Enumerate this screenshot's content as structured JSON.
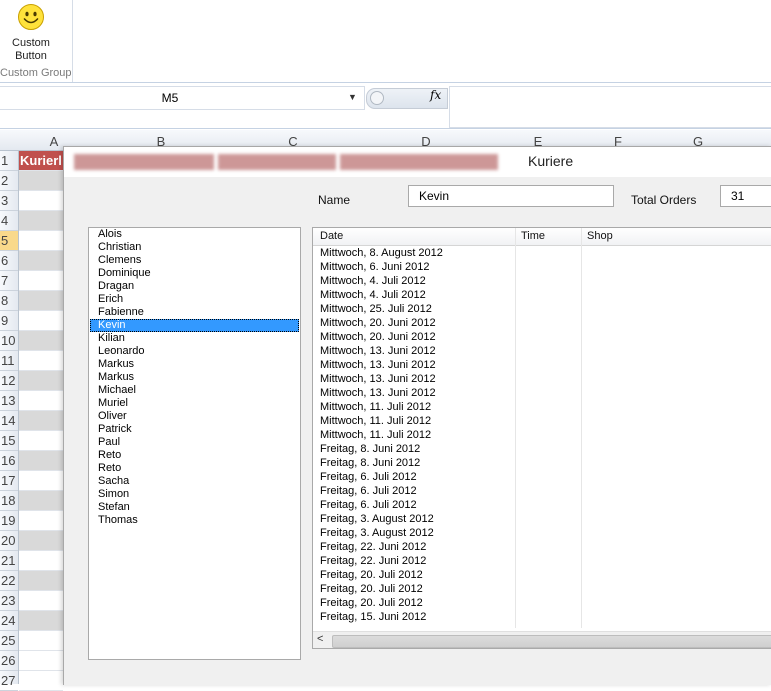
{
  "ribbon": {
    "button_label_1": "Custom",
    "button_label_2": "Button",
    "group_label": "Custom Group"
  },
  "formula_bar": {
    "name_box": "M5",
    "fx_label": "fx",
    "formula": ""
  },
  "sheet": {
    "columns": [
      "A",
      "B",
      "C",
      "D",
      "E",
      "F",
      "G"
    ],
    "rows": [
      "1",
      "2",
      "3",
      "4",
      "5",
      "6",
      "7",
      "8",
      "9",
      "10",
      "11",
      "12",
      "13",
      "14",
      "15",
      "16",
      "17",
      "18",
      "19",
      "20",
      "21",
      "22",
      "23",
      "24",
      "25",
      "26",
      "27"
    ],
    "selected_row": "5",
    "header_cell": "Kurierl"
  },
  "dialog": {
    "title": "Kuriere",
    "name_label": "Name",
    "name_value": "Kevin",
    "total_orders_label": "Total Orders",
    "total_orders_value": "31",
    "couriers": [
      "Alois",
      "Christian",
      "Clemens",
      "Dominique",
      "Dragan",
      "Erich",
      "Fabienne",
      "Kevin",
      "Kilian",
      "Leonardo",
      "Markus",
      "Markus",
      "Michael",
      "Muriel",
      "Oliver",
      "Patrick",
      "Paul",
      "Reto",
      "Reto",
      "Sacha",
      "Simon",
      "Stefan",
      "Thomas"
    ],
    "selected_courier": "Kevin",
    "columns": [
      "Date",
      "Time",
      "Shop"
    ],
    "orders": [
      "Mittwoch, 8. August 2012",
      "Mittwoch, 6. Juni 2012",
      "Mittwoch, 4. Juli 2012",
      "Mittwoch, 4. Juli 2012",
      "Mittwoch, 25. Juli 2012",
      "Mittwoch, 20. Juni 2012",
      "Mittwoch, 20. Juni 2012",
      "Mittwoch, 13. Juni 2012",
      "Mittwoch, 13. Juni 2012",
      "Mittwoch, 13. Juni 2012",
      "Mittwoch, 13. Juni 2012",
      "Mittwoch, 11. Juli 2012",
      "Mittwoch, 11. Juli 2012",
      "Mittwoch, 11. Juli 2012",
      "Freitag, 8. Juni 2012",
      "Freitag, 8. Juni 2012",
      "Freitag, 6. Juli 2012",
      "Freitag, 6. Juli 2012",
      "Freitag, 6. Juli 2012",
      "Freitag, 3. August 2012",
      "Freitag, 3. August 2012",
      "Freitag, 22. Juni 2012",
      "Freitag, 22. Juni 2012",
      "Freitag, 20. Juli 2012",
      "Freitag, 20. Juli 2012",
      "Freitag, 20. Juli 2012",
      "Freitag, 15. Juni 2012"
    ]
  }
}
